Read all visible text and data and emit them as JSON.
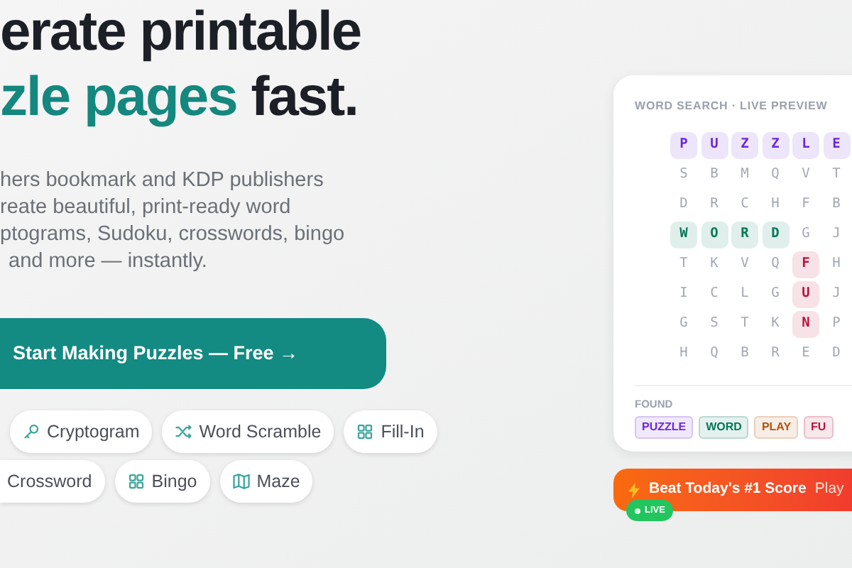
{
  "hero": {
    "title_line_1": "erate printable",
    "title_line_2_accent": "zle pages",
    "title_line_2_rest": "fast.",
    "description_lines": [
      "hers bookmark and KDP publishers",
      "reate beautiful, print-ready word",
      "ptograms, Sudoku, crosswords, bingo",
      "and more — instantly."
    ],
    "cta": "Start Making Puzzles — Free →",
    "chip_rows": [
      [
        {
          "label": "Cryptogram",
          "kind": "key"
        },
        {
          "label": "Word Scramble",
          "kind": "shuffle"
        },
        {
          "label": "Fill-In",
          "kind": "grid"
        }
      ],
      [
        {
          "label": "Crossword",
          "kind": "plain"
        },
        {
          "label": "Bingo",
          "kind": "grid"
        },
        {
          "label": "Maze",
          "kind": "map"
        }
      ]
    ]
  },
  "preview": {
    "title": "WORD SEARCH · LIVE PREVIEW",
    "grid": [
      [
        {
          "letter": "P",
          "color": "#6d28d9"
        },
        {
          "letter": "U",
          "color": "#6d28d9"
        },
        {
          "letter": "Z",
          "color": "#6d28d9"
        },
        {
          "letter": "Z",
          "color": "#6d28d9"
        },
        {
          "letter": "L",
          "color": "#6d28d9"
        },
        {
          "letter": "E",
          "color": "#6d28d9"
        }
      ],
      [
        {
          "letter": "S"
        },
        {
          "letter": "B"
        },
        {
          "letter": "M"
        },
        {
          "letter": "Q"
        },
        {
          "letter": "V"
        },
        {
          "letter": "T"
        }
      ],
      [
        {
          "letter": "D"
        },
        {
          "letter": "R"
        },
        {
          "letter": "C"
        },
        {
          "letter": "H"
        },
        {
          "letter": "F"
        },
        {
          "letter": "B"
        }
      ],
      [
        {
          "letter": "W",
          "color": "#047857"
        },
        {
          "letter": "O",
          "color": "#047857"
        },
        {
          "letter": "R",
          "color": "#047857"
        },
        {
          "letter": "D",
          "color": "#047857"
        },
        {
          "letter": "G"
        },
        {
          "letter": "J"
        }
      ],
      [
        {
          "letter": "T"
        },
        {
          "letter": "K"
        },
        {
          "letter": "V"
        },
        {
          "letter": "Q"
        },
        {
          "letter": "F",
          "color": "#be123c"
        },
        {
          "letter": "H"
        }
      ],
      [
        {
          "letter": "I"
        },
        {
          "letter": "C"
        },
        {
          "letter": "L"
        },
        {
          "letter": "G"
        },
        {
          "letter": "U",
          "color": "#be123c"
        },
        {
          "letter": "J"
        }
      ],
      [
        {
          "letter": "G"
        },
        {
          "letter": "S"
        },
        {
          "letter": "T"
        },
        {
          "letter": "K"
        },
        {
          "letter": "N",
          "color": "#be123c"
        },
        {
          "letter": "P"
        }
      ],
      [
        {
          "letter": "H"
        },
        {
          "letter": "Q"
        },
        {
          "letter": "B"
        },
        {
          "letter": "R"
        },
        {
          "letter": "E"
        },
        {
          "letter": "D"
        }
      ]
    ],
    "found_label": "FOUND",
    "found": [
      {
        "word": "PUZZLE",
        "color": "#6d28d9"
      },
      {
        "word": "WORD",
        "color": "#047857"
      },
      {
        "word": "PLAY",
        "color": "#b45309"
      },
      {
        "word": "FU",
        "color": "#be123c"
      }
    ]
  },
  "banner": {
    "text": "Beat Today's #1 Score",
    "subtext": "Play",
    "badge": "LIVE"
  }
}
